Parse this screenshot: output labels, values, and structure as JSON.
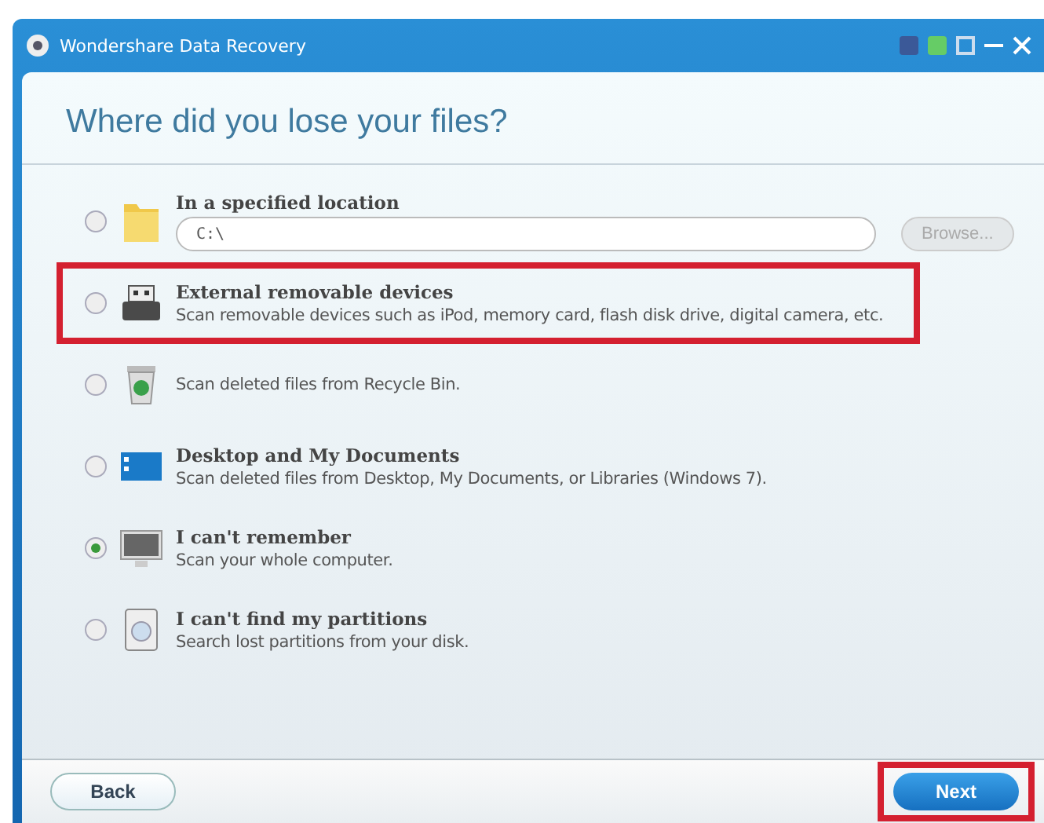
{
  "window": {
    "title": "Wondershare Data Recovery"
  },
  "heading": "Where did you lose your files?",
  "options": [
    {
      "kind": "location",
      "title": "In a specified location",
      "path": "C:\\",
      "browse": "Browse...",
      "selected": false,
      "highlighted": false
    },
    {
      "kind": "plain",
      "title": "External removable devices",
      "description": "Scan removable devices such as iPod, memory card, flash disk drive, digital camera, etc.",
      "selected": false,
      "highlighted": true
    },
    {
      "kind": "plain",
      "description": "Scan deleted files from Recycle Bin.",
      "selected": false,
      "highlighted": false
    },
    {
      "kind": "plain",
      "title": "Desktop and My Documents",
      "description": "Scan deleted files from Desktop, My Documents, or Libraries (Windows 7).",
      "selected": false,
      "highlighted": false
    },
    {
      "kind": "plain",
      "title": "I can't remember",
      "description": "Scan your whole computer.",
      "selected": true,
      "highlighted": false
    },
    {
      "kind": "plain",
      "title": "I can't find my partitions",
      "description": "Search lost partitions from your disk.",
      "selected": false,
      "highlighted": false
    }
  ],
  "footer": {
    "back": "Back",
    "next": "Next",
    "next_highlighted": true
  }
}
